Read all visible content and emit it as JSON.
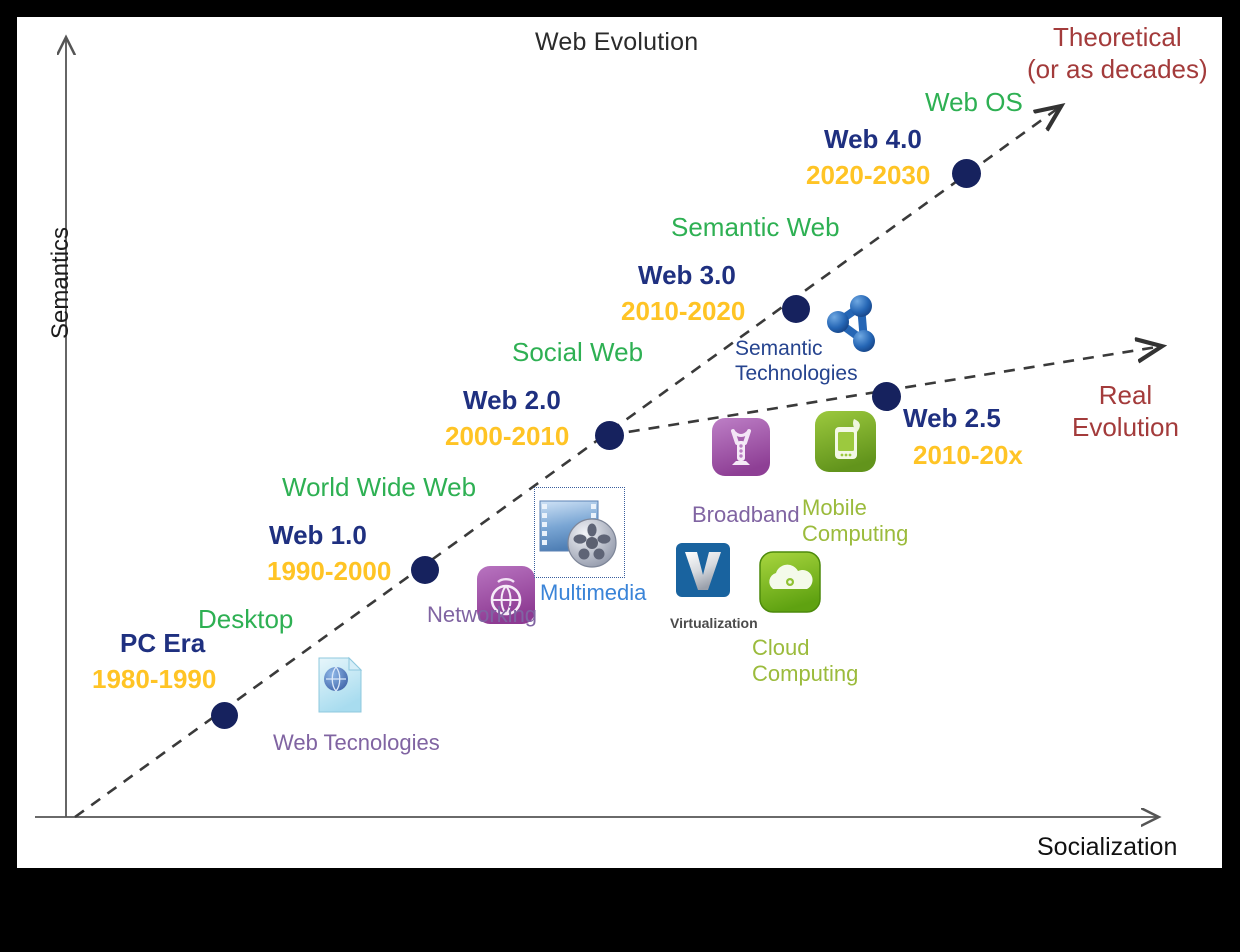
{
  "title": "Web Evolution",
  "axes": {
    "y_label": "Semantics",
    "x_label": "Socialization"
  },
  "annotations": {
    "theoretical_line1": "Theoretical",
    "theoretical_line2": "(or as decades)",
    "real_line1": "Real",
    "real_line2": "Evolution"
  },
  "colors": {
    "era": "#1f3080",
    "years": "#ffc425",
    "webname": "#2eb053",
    "evolution_label": "#a33b3b",
    "dot": "#16225e",
    "background": "#ffffff",
    "frame": "#000000"
  },
  "stages": [
    {
      "era": "PC Era",
      "years": "1980-1990",
      "webname": "Desktop"
    },
    {
      "era": "Web 1.0",
      "years": "1990-2000",
      "webname": "World Wide Web"
    },
    {
      "era": "Web 2.0",
      "years": "2000-2010",
      "webname": "Social Web"
    },
    {
      "era": "Web 3.0",
      "years": "2010-2020",
      "webname": "Semantic Web"
    },
    {
      "era": "Web 4.0",
      "years": "2020-2030",
      "webname": "Web OS"
    },
    {
      "era": "Web 2.5",
      "years": "2010-20x",
      "webname": ""
    }
  ],
  "technologies": [
    {
      "label": "Web Tecnologies",
      "icon": "document-globe-icon"
    },
    {
      "label": "Networking",
      "icon": "globe-signal-icon"
    },
    {
      "label": "Multimedia",
      "icon": "film-reel-icon"
    },
    {
      "label": "Broadband",
      "icon": "antenna-tower-icon"
    },
    {
      "label": "Mobile Computing",
      "icon": "mobile-phone-icon"
    },
    {
      "label": "Virtualization",
      "icon": "vmware-v-icon"
    },
    {
      "label": "Cloud Computing",
      "icon": "cloud-gear-icon"
    },
    {
      "label": "Semantic Technologies",
      "icon": "molecule-nodes-icon"
    }
  ],
  "chart_data": {
    "type": "scatter",
    "title": "Web Evolution",
    "xlabel": "Socialization",
    "ylabel": "Semantics",
    "grid": false,
    "legend": "none",
    "series": [
      {
        "name": "Theoretical (or as decades)",
        "points": [
          {
            "label": "PC Era",
            "years": "1980-1990",
            "x": 0.17,
            "y": 0.16
          },
          {
            "label": "Web 1.0",
            "years": "1990-2000",
            "x": 0.35,
            "y": 0.33
          },
          {
            "label": "Web 2.0",
            "years": "2000-2010",
            "x": 0.5,
            "y": 0.49
          },
          {
            "label": "Web 3.0",
            "years": "2010-2020",
            "x": 0.66,
            "y": 0.64
          },
          {
            "label": "Web 4.0",
            "years": "2020-2030",
            "x": 0.8,
            "y": 0.8
          }
        ]
      },
      {
        "name": "Real Evolution",
        "points": [
          {
            "label": "Web 2.0",
            "years": "2000-2010",
            "x": 0.5,
            "y": 0.49
          },
          {
            "label": "Web 2.5",
            "years": "2010-20x",
            "x": 0.73,
            "y": 0.55
          }
        ]
      }
    ]
  }
}
